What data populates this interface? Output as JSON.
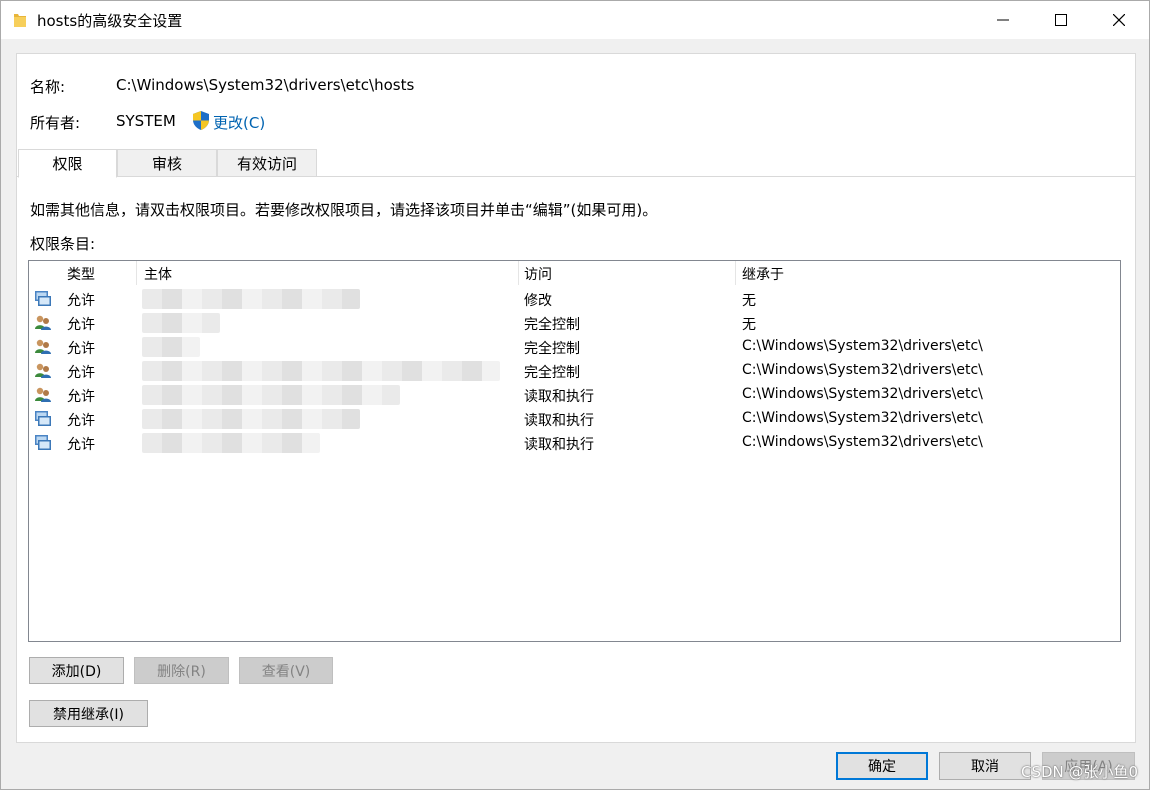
{
  "window": {
    "title": "hosts的高级安全设置"
  },
  "header": {
    "name_label": "名称:",
    "name_value": "C:\\Windows\\System32\\drivers\\etc\\hosts",
    "owner_label": "所有者:",
    "owner_value": "SYSTEM",
    "change_link": "更改(C)"
  },
  "tabs": [
    {
      "label": "权限",
      "active": true
    },
    {
      "label": "审核",
      "active": false
    },
    {
      "label": "有效访问",
      "active": false
    }
  ],
  "info_text": "如需其他信息，请双击权限项目。若要修改权限项目，请选择该项目并单击“编辑”(如果可用)。",
  "entries_label": "权限条目:",
  "list": {
    "columns": [
      "类型",
      "主体",
      "访问",
      "继承于"
    ],
    "rows": [
      {
        "icon": "computer-group-icon",
        "type": "允许",
        "principal": "",
        "access": "修改",
        "inherited": "无"
      },
      {
        "icon": "users-group-icon",
        "type": "允许",
        "principal": "",
        "access": "完全控制",
        "inherited": "无"
      },
      {
        "icon": "users-group-icon",
        "type": "允许",
        "principal": "",
        "access": "完全控制",
        "inherited": "C:\\Windows\\System32\\drivers\\etc\\"
      },
      {
        "icon": "users-group-icon",
        "type": "允许",
        "principal": "",
        "access": "完全控制",
        "inherited": "C:\\Windows\\System32\\drivers\\etc\\"
      },
      {
        "icon": "users-group-icon",
        "type": "允许",
        "principal": "",
        "access": "读取和执行",
        "inherited": "C:\\Windows\\System32\\drivers\\etc\\"
      },
      {
        "icon": "computer-group-icon",
        "type": "允许",
        "principal": "",
        "access": "读取和执行",
        "inherited": "C:\\Windows\\System32\\drivers\\etc\\"
      },
      {
        "icon": "computer-group-icon",
        "type": "允许",
        "principal": "",
        "access": "读取和执行",
        "inherited": "C:\\Windows\\System32\\drivers\\etc\\"
      }
    ]
  },
  "buttons": {
    "add": "添加(D)",
    "remove": "删除(R)",
    "view": "查看(V)",
    "disable_inheritance": "禁用继承(I)",
    "ok": "确定",
    "cancel": "取消",
    "apply": "应用(A)"
  },
  "watermark": "CSDN @张小鱼0",
  "colors": {
    "link": "#0063b1",
    "accent": "#0078d7"
  }
}
